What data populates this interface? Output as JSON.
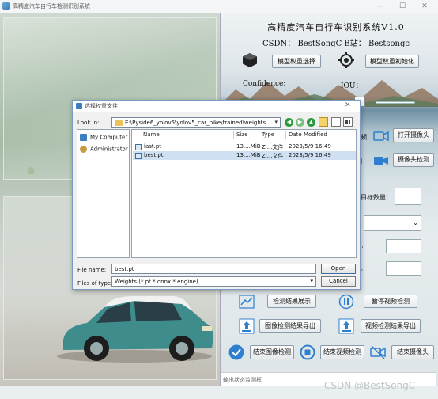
{
  "window": {
    "title": "高精度汽车自行车检测识别系统",
    "minimize": "—",
    "maximize": "☐",
    "close": "✕"
  },
  "header": {
    "title": "高精度汽车自行车识别系统V1.0",
    "credits": "CSDN：  BestSongC    B站：  Bestsongc"
  },
  "controls": {
    "select_weights": "模型权重选择",
    "init_weights": "模型权重初始化",
    "confidence_label": "Confidence:",
    "iou_label": "IOU：",
    "open_camera": "打开摄像头",
    "camera_detect": "摄像头检测",
    "target_count_label": "目标数量：",
    "show_results": "检测结果展示",
    "pause_video": "暂停视频检测",
    "export_image_results": "图像检测结果导出",
    "export_video_results": "视频检测结果导出",
    "end_image_detect": "结束图像检测",
    "end_video_detect": "结束视频检测",
    "end_camera": "结束摄像头",
    "partial_label_1": "视频",
    "partial_label_2": "测",
    "partial_label_3": "n:",
    "partial_label_4": "x:"
  },
  "status_bar": {
    "text": "输出状态监测框"
  },
  "watermark": "CSDN @BestSongC",
  "dialog": {
    "title": "选择权重文件",
    "close": "✕",
    "look_in_label": "Look in:",
    "look_in_path": "E:\\Pyside6_yolov5\\yolov5_car_bike\\trained\\weights",
    "sidebar": [
      {
        "label": "My Computer",
        "icon": "computer-icon"
      },
      {
        "label": "Administrator",
        "icon": "user-icon"
      }
    ],
    "columns": [
      "Name",
      "Size",
      "Type",
      "Date Modified"
    ],
    "files": [
      {
        "name": "last.pt",
        "size": "13....MiB",
        "type": "Zi...文件",
        "date": "2023/5/9 16:49",
        "selected": false
      },
      {
        "name": "best.pt",
        "size": "13....MiB",
        "type": "Zi...文件",
        "date": "2023/5/9 16:49",
        "selected": true
      }
    ],
    "file_name_label": "File name:",
    "file_name_value": "best.pt",
    "file_type_label": "Files of type:",
    "file_type_value": "Weights (*.pt *.onnx *.engine)",
    "open_label": "Open",
    "cancel_label": "Cancel"
  },
  "colors": {
    "accent_blue": "#2f7fd1",
    "dialog_border": "#7a9cc4",
    "selected_row": "#cfe0f2"
  }
}
